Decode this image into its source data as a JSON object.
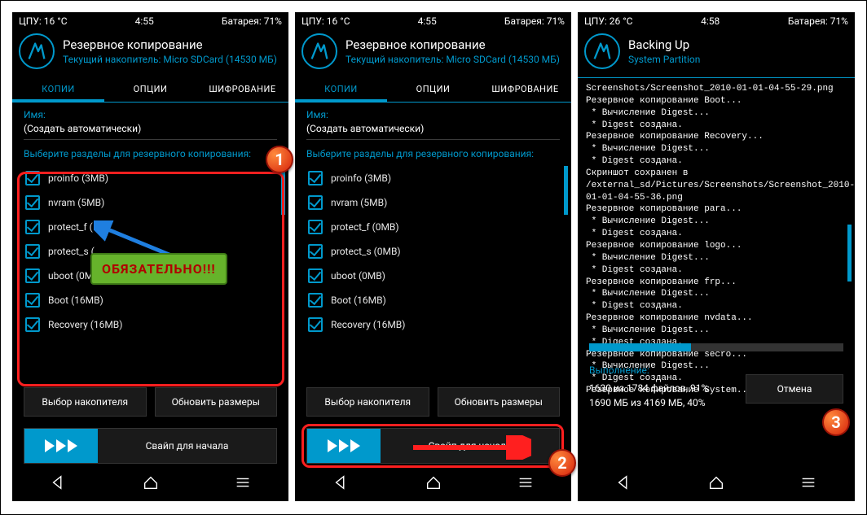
{
  "p1": {
    "status": {
      "cpu": "ЦПУ: 16 °C",
      "time": "4:55",
      "batt": "Батарея: 71%"
    },
    "header": {
      "title": "Резервное копирование",
      "sub": "Текущий накопитель: Micro SDCard (14530 МБ)"
    },
    "tabs": {
      "copies": "КОПИИ",
      "options": "ОПЦИИ",
      "encrypt": "ШИФРОВАНИЕ"
    },
    "nameLabel": "Имя:",
    "nameValue": "(Создать автоматически)",
    "sectionTitle": "Выберите разделы для резервного копирования:",
    "items": [
      {
        "label": "proinfo (3MB)"
      },
      {
        "label": "nvram (5MB)"
      },
      {
        "label": "protect_f (0MB)",
        "labelShort": "protect_f ("
      },
      {
        "label": "protect_s (0MB)",
        "labelShort": "protect_s ("
      },
      {
        "label": "uboot (0MB)"
      },
      {
        "label": "Boot (16MB)"
      },
      {
        "label": "Recovery (16MB)"
      }
    ],
    "btnStorage": "Выбор накопителя",
    "btnRefresh": "Обновить размеры",
    "swipe": "Свайп для начала",
    "callout": "ОБЯЗАТЕЛЬНО!!!"
  },
  "p2": {
    "status": {
      "cpu": "ЦПУ: 16 °C",
      "time": "4:55",
      "batt": "Батарея: 71%"
    },
    "header": {
      "title": "Резервное копирование",
      "sub": "Текущий накопитель: Micro SDCard (14530 МБ)"
    },
    "tabs": {
      "copies": "КОПИИ",
      "options": "ОПЦИИ",
      "encrypt": "ШИФРОВАНИЕ"
    },
    "nameLabel": "Имя:",
    "nameValue": "(Создать автоматически)",
    "sectionTitle": "Выберите разделы для резервного копирования:",
    "items": [
      {
        "label": "proinfo (3MB)"
      },
      {
        "label": "nvram (5MB)"
      },
      {
        "label": "protect_f (0MB)"
      },
      {
        "label": "protect_s (0MB)"
      },
      {
        "label": "uboot (0MB)"
      },
      {
        "label": "Boot (16MB)"
      },
      {
        "label": "Recovery (16MB)"
      }
    ],
    "btnStorage": "Выбор накопителя",
    "btnRefresh": "Обновить размеры",
    "swipe": "Свайп для начала"
  },
  "p3": {
    "status": {
      "cpu": "ЦПУ: 26 °C",
      "time": "4:58",
      "batt": "Батарея: 71%"
    },
    "header": {
      "title": "Backing Up",
      "sub": "System Partition"
    },
    "log": "Screenshots/Screenshot_2010-01-01-04-55-29.png\nРезервное копирование Boot...\n * Вычисление Digest...\n * Digest создана.\nРезервное копирование Recovery...\n * Вычисление Digest...\n * Digest создана.\nСкриншот сохранен в /external_sd/Pictures/Screenshots/Screenshot_2010-01-01-04-55-36.png\nРезервное копирование para...\n * Вычисление Digest...\n * Digest создана.\nРезервное копирование logo...\n * Вычисление Digest...\n * Digest создана.\nРезервное копирование frp...\n * Вычисление Digest...\n * Digest создана.\nРезервное копирование nvdata...\n * Вычисление Digest...\n * Digest создана.\nРезервное копирование secro...\n * Вычисление Digest...\n * Digest создана.\nРезервное копирование System...",
    "progressPct": 40,
    "execLabel": "Выполнение:",
    "line1": "1630 из 1784 файлов, 91%",
    "line2": "1690 МБ из 4169 МБ, 40%",
    "cancel": "Отмена"
  },
  "markers": {
    "m1": "1",
    "m2": "2",
    "m3": "3"
  }
}
